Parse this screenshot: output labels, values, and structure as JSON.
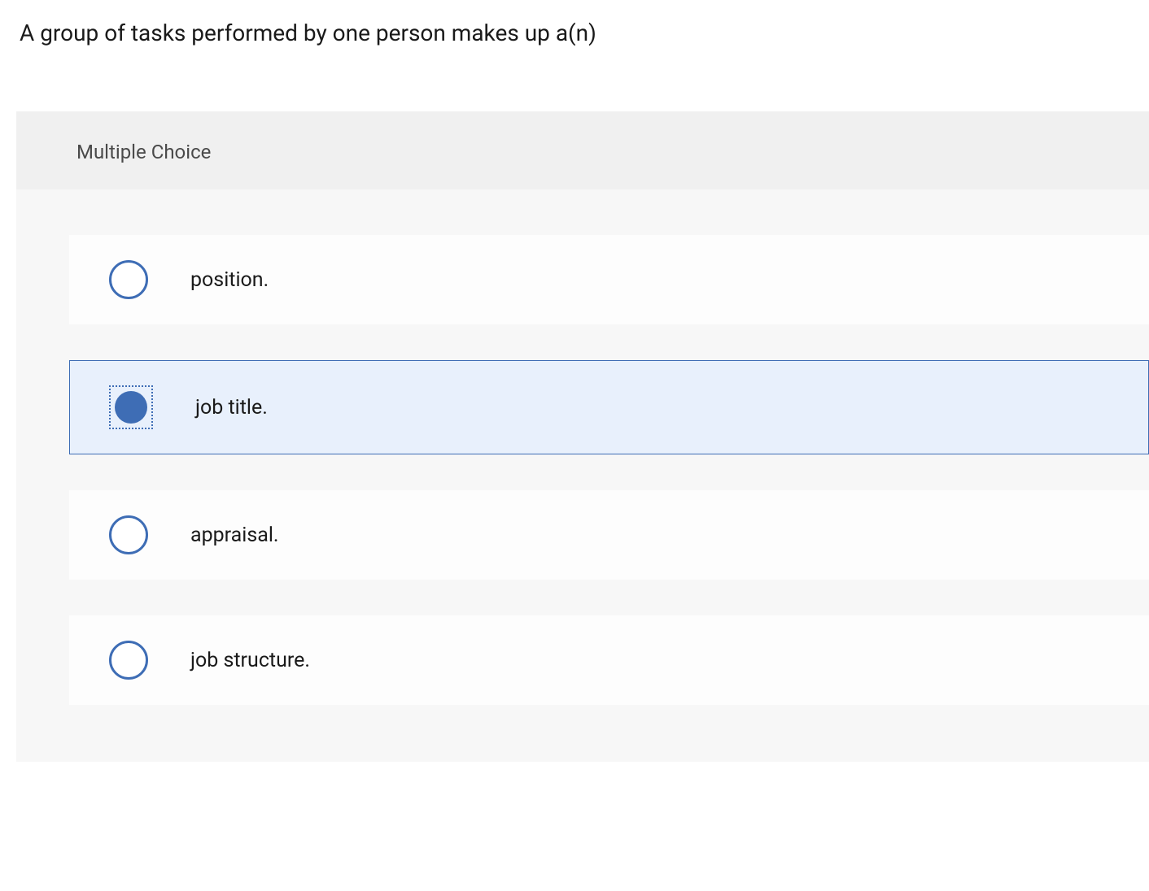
{
  "question": {
    "text": "A group of tasks performed by one person makes up a(n)",
    "type_label": "Multiple Choice"
  },
  "options": [
    {
      "label": "position.",
      "selected": false
    },
    {
      "label": "job title.",
      "selected": true
    },
    {
      "label": "appraisal.",
      "selected": false
    },
    {
      "label": "job structure.",
      "selected": false
    }
  ]
}
